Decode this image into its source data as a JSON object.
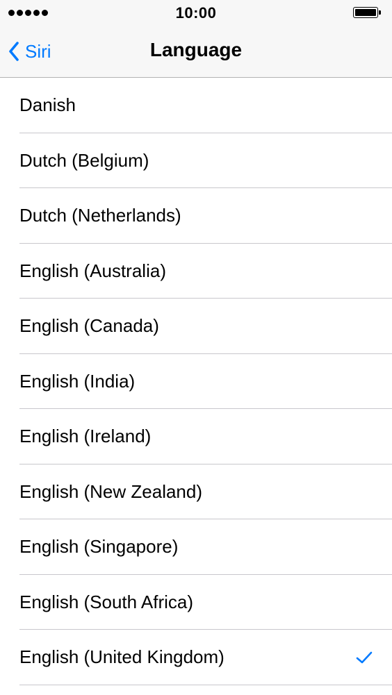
{
  "status_bar": {
    "time": "10:00",
    "signal_icon": "signal-dots-icon",
    "battery_icon": "battery-full-icon"
  },
  "nav": {
    "back_label": "Siri",
    "back_icon": "chevron-left-icon",
    "title": "Language"
  },
  "colors": {
    "accent": "#007aff",
    "bar_background": "#f7f7f7",
    "separator": "#c8c7cc"
  },
  "languages": [
    {
      "label": "Danish",
      "selected": false
    },
    {
      "label": "Dutch (Belgium)",
      "selected": false
    },
    {
      "label": "Dutch (Netherlands)",
      "selected": false
    },
    {
      "label": "English (Australia)",
      "selected": false
    },
    {
      "label": "English (Canada)",
      "selected": false
    },
    {
      "label": "English (India)",
      "selected": false
    },
    {
      "label": "English (Ireland)",
      "selected": false
    },
    {
      "label": "English (New Zealand)",
      "selected": false
    },
    {
      "label": "English (Singapore)",
      "selected": false
    },
    {
      "label": "English (South Africa)",
      "selected": false
    },
    {
      "label": "English (United Kingdom)",
      "selected": true
    }
  ]
}
